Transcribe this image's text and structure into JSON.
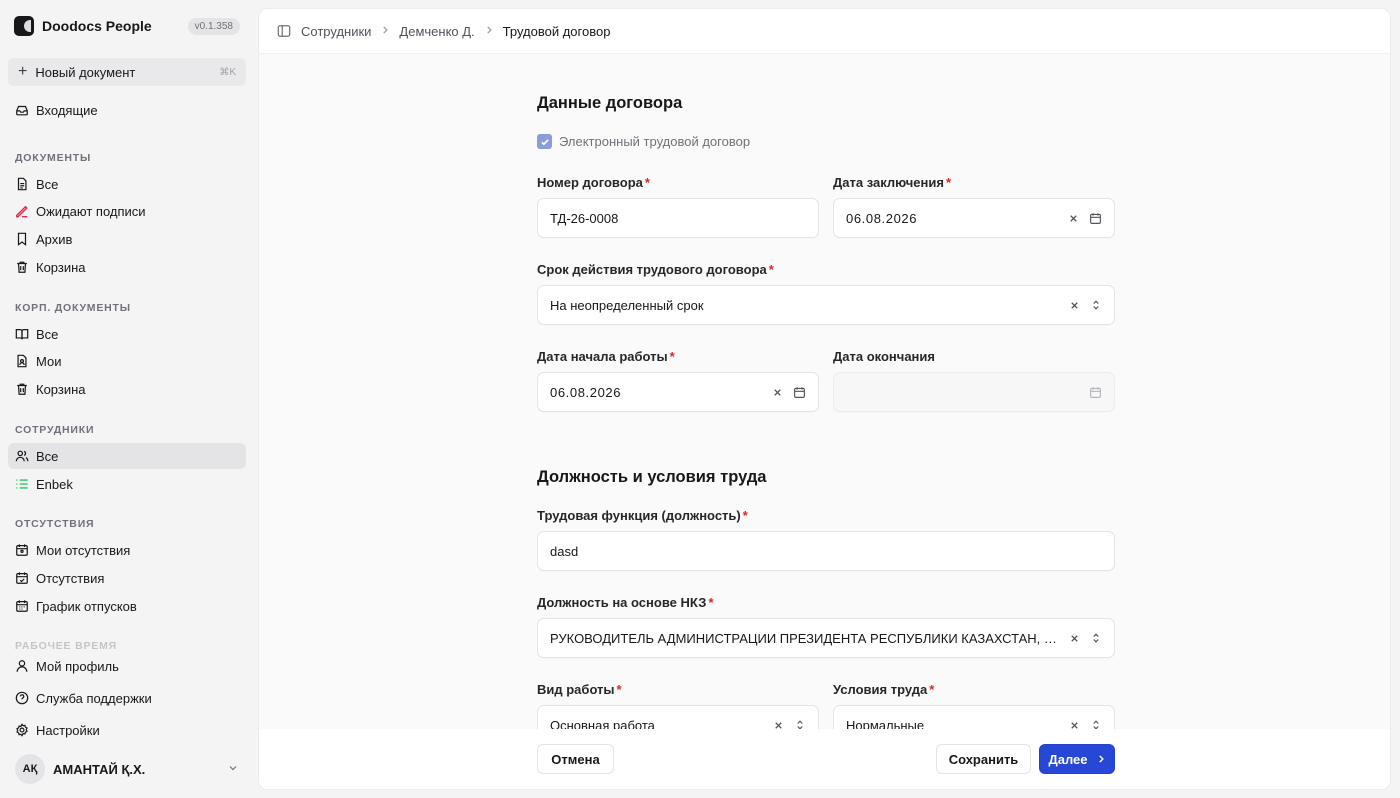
{
  "app": {
    "name": "Doodocs People",
    "version": "v0.1.358"
  },
  "sidebar": {
    "new_doc": {
      "label": "Новый документ",
      "shortcut": "⌘K"
    },
    "inbox": "Входящие",
    "sections": {
      "documents": "ДОКУМЕНТЫ",
      "corp_documents": "КОРП. ДОКУМЕНТЫ",
      "employees": "СОТРУДНИКИ",
      "absences": "ОТСУТСТВИЯ",
      "work_time": "РАБОЧЕЕ ВРЕМЯ"
    },
    "documents": {
      "all": "Все",
      "awaiting": "Ожидают подписи",
      "archive": "Архив",
      "trash": "Корзина"
    },
    "corp": {
      "all": "Все",
      "mine": "Мои",
      "trash": "Корзина"
    },
    "employees": {
      "all": "Все",
      "enbek": "Enbek"
    },
    "absences": {
      "mine": "Мои отсутствия",
      "all": "Отсутствия",
      "schedule": "График отпусков"
    },
    "bottom": {
      "profile": "Мой профиль",
      "support": "Служба поддержки",
      "settings": "Настройки"
    },
    "user": {
      "initials": "АҚ",
      "name": "АМАНТАЙ Қ.Х."
    }
  },
  "breadcrumb": {
    "item1": "Сотрудники",
    "item2": "Демченко Д.",
    "item3": "Трудовой договор"
  },
  "form": {
    "section1_title": "Данные договора",
    "electronic_label": "Электронный трудовой договор",
    "electronic_checked": true,
    "contract_number": {
      "label": "Номер договора",
      "value": "ТД-26-0008"
    },
    "conclusion_date": {
      "label": "Дата заключения",
      "value": "06.08.2026"
    },
    "term": {
      "label": "Срок действия трудового договора",
      "value": "На неопределенный срок"
    },
    "start_date": {
      "label": "Дата начала работы",
      "value": "06.08.2026"
    },
    "end_date": {
      "label": "Дата окончания",
      "value": ""
    },
    "section2_title": "Должность и условия труда",
    "labor_function": {
      "label": "Трудовая функция (должность)",
      "value": "dasd"
    },
    "nkz_position": {
      "label": "Должность на основе НКЗ",
      "value": "РУКОВОДИТЕЛЬ АДМИНИСТРАЦИИ ПРЕЗИДЕНТА РЕСПУБЛИКИ КАЗАХСТАН, ЕГО ЗАМЕСТИТЕЛИ"
    },
    "work_type": {
      "label": "Вид работы",
      "value": "Основная работа"
    },
    "work_conditions": {
      "label": "Условия труда",
      "value": "Нормальные"
    }
  },
  "footer": {
    "cancel": "Отмена",
    "save": "Сохранить",
    "next": "Далее"
  },
  "colors": {
    "accent": "#2747d6",
    "required": "#dc2626",
    "checkbox": "#8b9cd8"
  }
}
